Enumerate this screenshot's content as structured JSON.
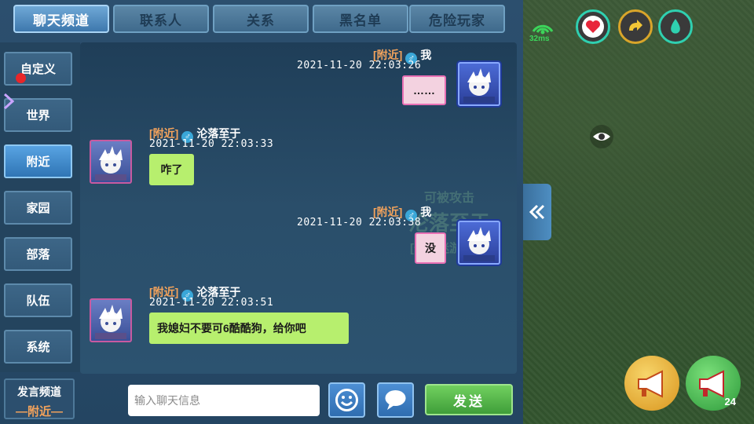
{
  "tabs": [
    "聊天频道",
    "联系人",
    "关系",
    "黑名单",
    "危险玩家"
  ],
  "sidebar": [
    "自定义",
    "世界",
    "附近",
    "家园",
    "部落",
    "队伍",
    "系统"
  ],
  "watermark": {
    "line1": "可被攻击",
    "line2": "沦落至于",
    "line3": "[七彩迷游长老]"
  },
  "messages": [
    {
      "channel": "[附近]",
      "gender": "♂",
      "name": "我",
      "time": "2021-11-20  22:03:26",
      "text": "……"
    },
    {
      "channel": "[附近]",
      "gender": "♂",
      "name": "沦落至于",
      "time": "2021-11-20  22:03:33",
      "text": "咋了"
    },
    {
      "channel": "[附近]",
      "gender": "♂",
      "name": "我",
      "time": "2021-11-20  22:03:38",
      "text": "没"
    },
    {
      "channel": "[附近]",
      "gender": "♂",
      "name": "沦落至于",
      "time": "2021-11-20  22:03:51",
      "text": "我媳妇不要可6酷酷狗，给你吧"
    }
  ],
  "bottom": {
    "channel_title": "发言频道",
    "channel_value": "—附近—",
    "input_placeholder": "输入聊天信息",
    "send_label": "发送"
  },
  "hud": {
    "ping": "32ms",
    "broadcast_count": "24"
  },
  "icons": {
    "emoji": "smiley-icon",
    "chat": "speech-bubble-icon",
    "collapse": "double-chevron-left-icon",
    "eye": "eye-icon",
    "heart": "heart-icon",
    "hunger": "food-icon",
    "water": "water-drop-icon",
    "signal": "wifi-signal-icon",
    "megaphone": "megaphone-icon"
  },
  "colors": {
    "channel_tag": "#f3a35c",
    "bubble_other": "#b7ef6e",
    "bubble_self": "#f3d2e0",
    "tab_active": "#3e78ad",
    "send_button": "#3f9e39"
  }
}
